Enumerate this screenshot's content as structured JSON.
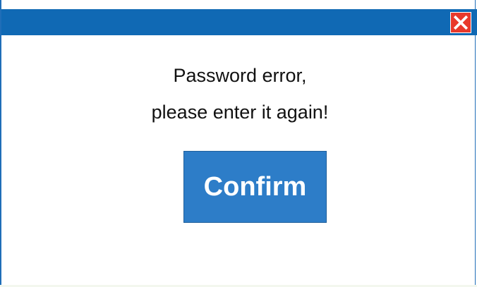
{
  "dialog": {
    "message_line1": "Password error,",
    "message_line2": "please enter it again!",
    "confirm_label": "Confirm",
    "close_icon": "close-icon"
  },
  "colors": {
    "titlebar": "#1069b4",
    "close_button": "#e8392b",
    "confirm_button": "#2d7dc8"
  }
}
